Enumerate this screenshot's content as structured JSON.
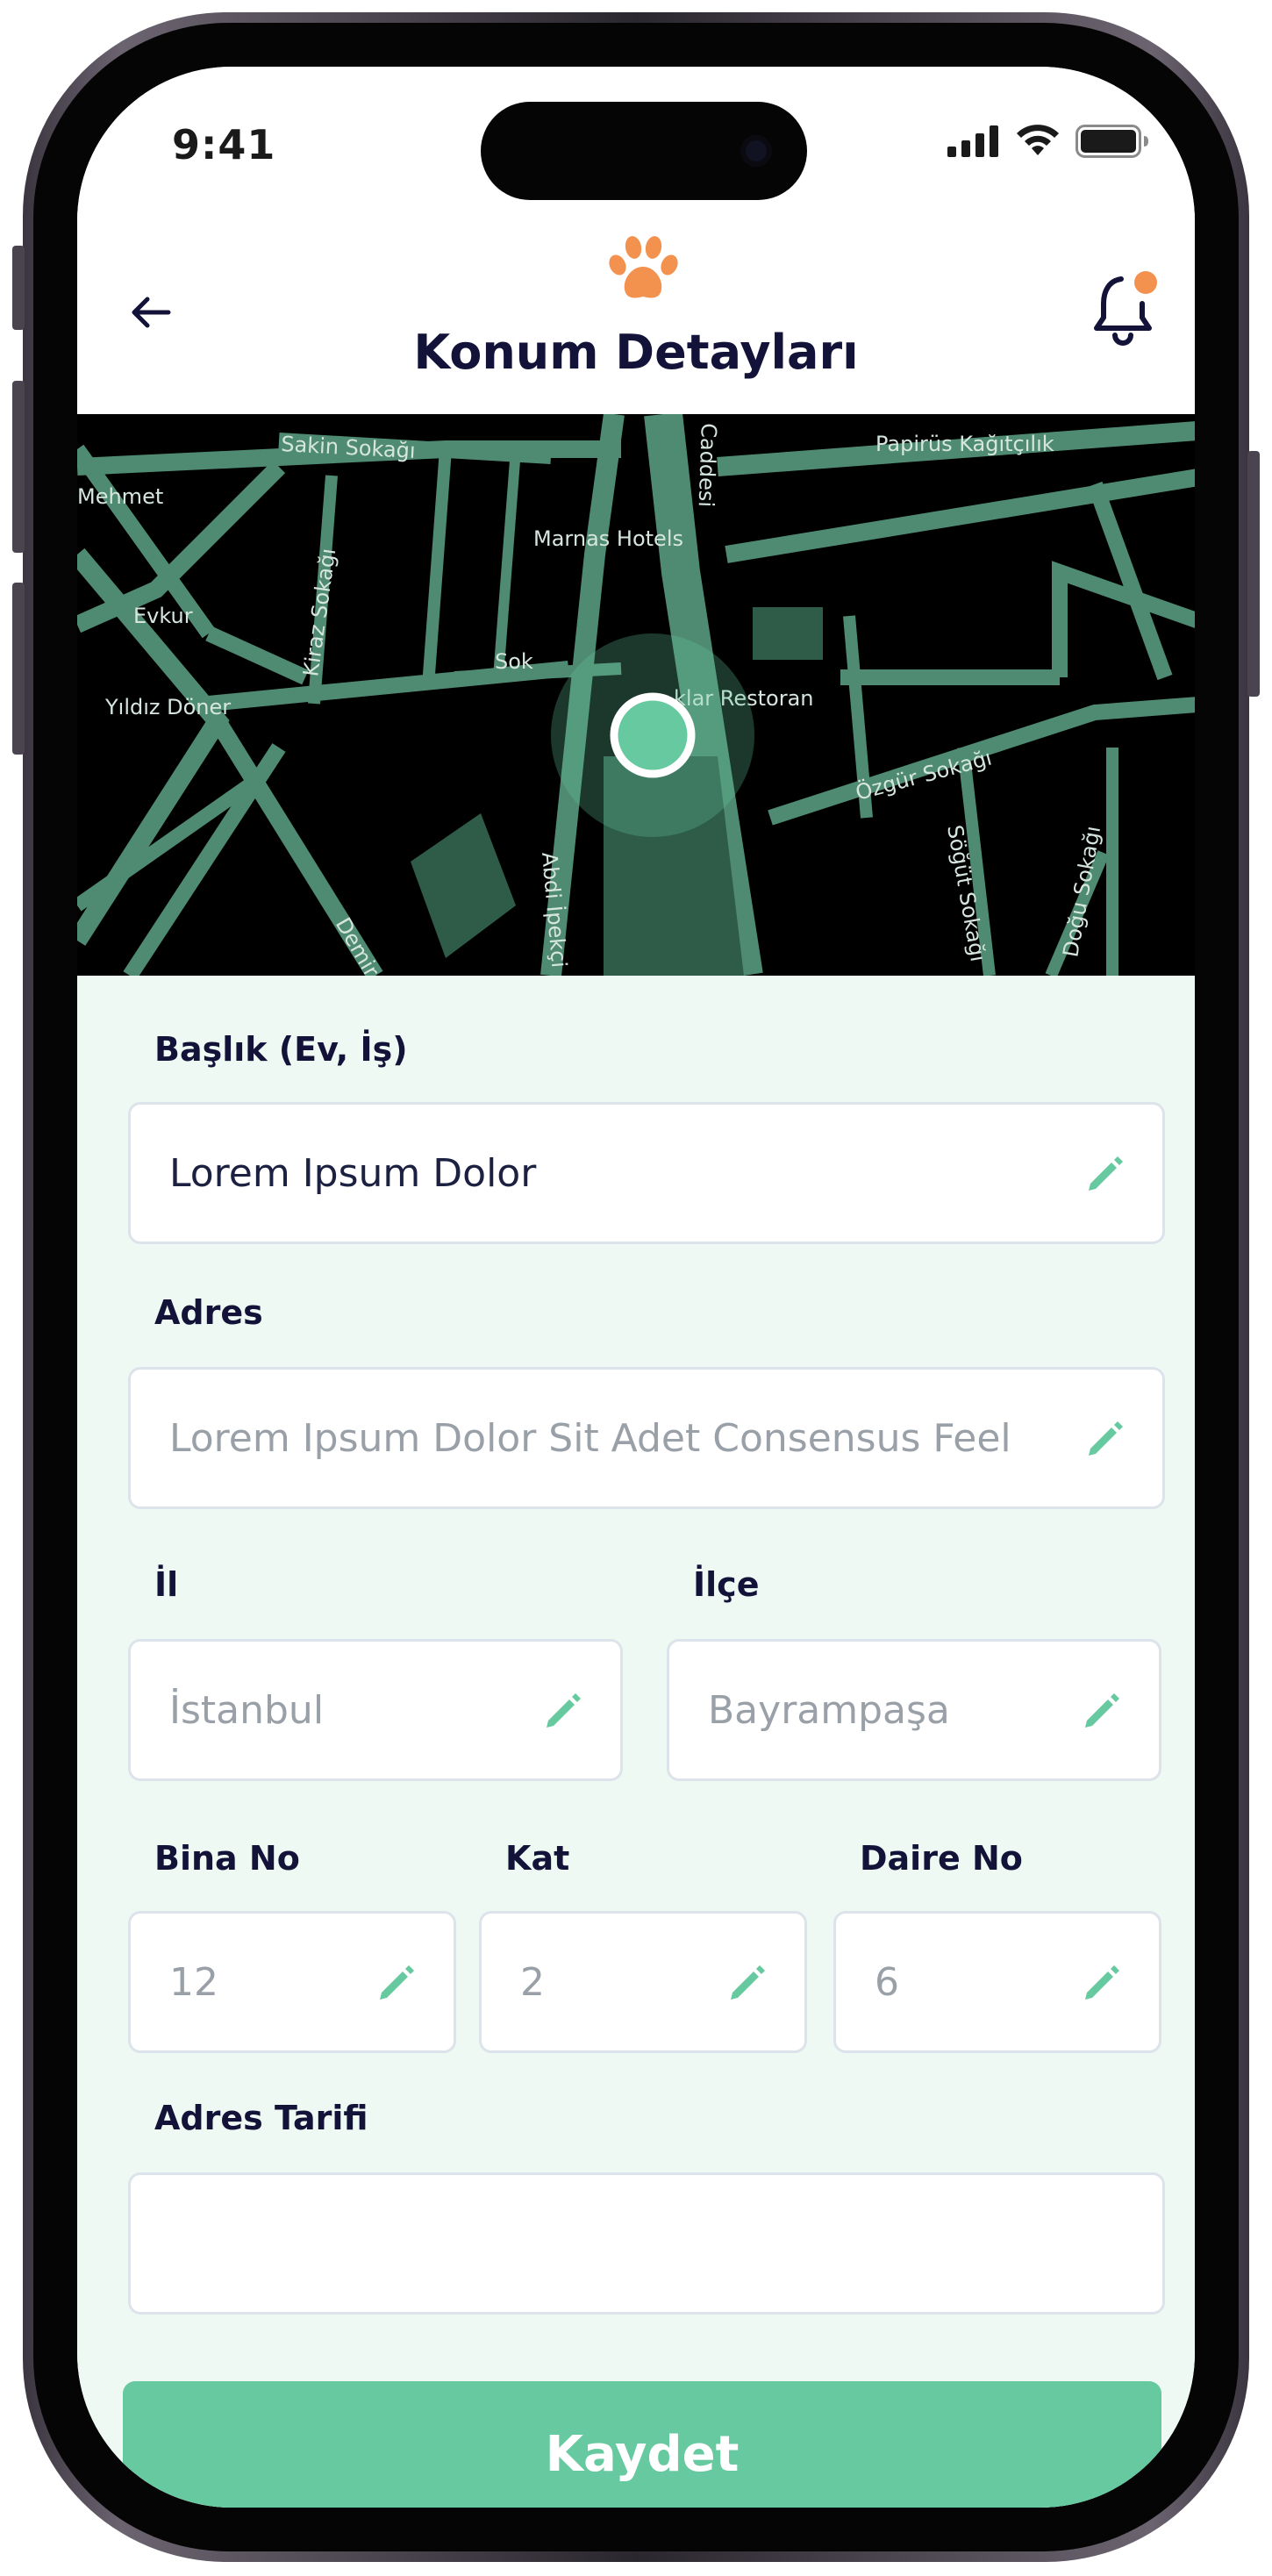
{
  "status_bar": {
    "time": "9:41"
  },
  "header": {
    "title": "Konum Detayları",
    "back_icon": "arrow-left-icon",
    "logo_icon": "paw-icon",
    "bell_icon": "bell-icon"
  },
  "map": {
    "labels": {
      "sakin": "Sakin Sokağı",
      "mehmet": "Mehmet",
      "papirus": "Papirüs Kağıtçılık",
      "marnas": "Marnas Hotels",
      "evkur": "Evkur",
      "kiraz": "Kiraz Sokağı",
      "sok": "Sok",
      "restoran": "klar Restoran",
      "yildiz": "Yıldız Döner",
      "ozgur": "Özgür Sokağı",
      "sogut": "Söğüt Sokağı",
      "dogu": "Doğu Sokağı",
      "abdi": "Abdi İpekçi",
      "cadde": "Caddesi",
      "demir": "Demir"
    }
  },
  "form": {
    "title_field": {
      "label": "Başlık (Ev, İş)",
      "value": "Lorem Ipsum Dolor"
    },
    "address_field": {
      "label": "Adres",
      "placeholder": "Lorem Ipsum Dolor Sit Adet Consensus Feel"
    },
    "city_field": {
      "label": "İl",
      "placeholder": "İstanbul"
    },
    "district_field": {
      "label": "İlçe",
      "placeholder": "Bayrampaşa"
    },
    "building_field": {
      "label": "Bina No",
      "placeholder": "12"
    },
    "floor_field": {
      "label": "Kat",
      "placeholder": "2"
    },
    "apartment_field": {
      "label": "Daire No",
      "placeholder": "6"
    },
    "directions_field": {
      "label": "Adres Tarifi",
      "value": ""
    },
    "save_label": "Kaydet"
  },
  "colors": {
    "accent": "#66c9a0",
    "title": "#13133a",
    "logo": "#f3924f",
    "map_road": "#4f8b72",
    "background": "#edf9f2"
  }
}
